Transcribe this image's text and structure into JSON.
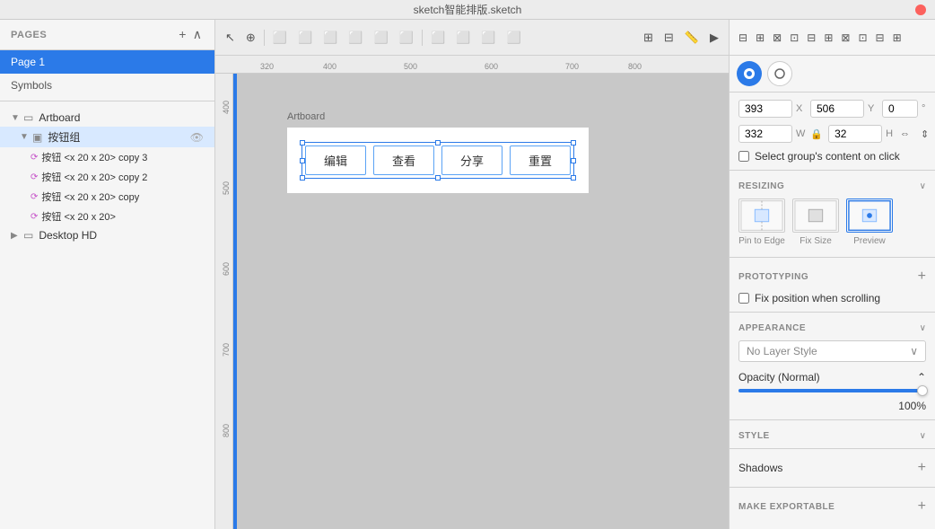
{
  "app": {
    "title": "sketch智能排版.sketch",
    "close_btn_label": "×"
  },
  "top_toolbar": {
    "align_buttons": [
      "⊞",
      "⊟",
      "⊠",
      "⊡",
      "⊞",
      "⊟",
      "⊠",
      "⊡"
    ],
    "align_labels": [
      "align-left",
      "align-center-h",
      "align-right",
      "align-top",
      "align-center-v",
      "align-bottom",
      "distribute-h",
      "distribute-v",
      "resize-w",
      "resize-h"
    ]
  },
  "left_panel": {
    "pages_label": "PAGES",
    "pages": [
      {
        "name": "Page 1",
        "active": true
      },
      {
        "name": "Symbols",
        "active": false
      }
    ],
    "layer_tree": [
      {
        "type": "artboard",
        "name": "Artboard",
        "level": 0,
        "expanded": true
      },
      {
        "type": "group",
        "name": "按钮组",
        "level": 1,
        "expanded": true,
        "has_eye": true
      },
      {
        "type": "symbol",
        "name": "按钮 <x 20 x 20>  copy 3",
        "level": 2
      },
      {
        "type": "symbol",
        "name": "按钮 <x 20 x 20>  copy 2",
        "level": 2
      },
      {
        "type": "symbol",
        "name": "按钮 <x 20 x 20>  copy",
        "level": 2
      },
      {
        "type": "symbol",
        "name": "按钮 <x 20 x 20>",
        "level": 2
      },
      {
        "type": "artboard",
        "name": "Desktop HD",
        "level": 0,
        "expanded": false
      }
    ]
  },
  "canvas": {
    "ruler_ticks_h": [
      "320",
      "400",
      "500",
      "600",
      "700",
      "800"
    ],
    "ruler_ticks_v": [
      "400",
      "500",
      "600",
      "700",
      "800"
    ],
    "artboard_label": "Artboard",
    "buttons": [
      {
        "label": "编辑"
      },
      {
        "label": "查看"
      },
      {
        "label": "分享"
      },
      {
        "label": "重置"
      }
    ]
  },
  "right_panel": {
    "style_tabs": [
      {
        "type": "fill",
        "label": "fill-icon",
        "icon": "◈"
      },
      {
        "type": "border",
        "label": "border-icon",
        "icon": "◎"
      }
    ],
    "properties": {
      "x_label": "X",
      "x_value": "393",
      "y_label": "Y",
      "y_value": "506",
      "rotation_value": "0",
      "rotation_unit": "°",
      "w_label": "W",
      "w_value": "332",
      "h_label": "H",
      "h_value": "32"
    },
    "checkbox_group_content": "Select group's content on click",
    "resizing": {
      "title": "RESIZING",
      "options": [
        {
          "label": "Pin to Edge",
          "selected": false
        },
        {
          "label": "Fix Size",
          "selected": false
        },
        {
          "label": "Preview",
          "selected": true
        }
      ]
    },
    "prototyping": {
      "title": "PROTOTYPING",
      "fix_position_label": "Fix position when scrolling"
    },
    "appearance": {
      "title": "APPEARANCE",
      "layer_style_placeholder": "No Layer Style"
    },
    "opacity": {
      "label": "Opacity (Normal)",
      "value": "100%",
      "slider_value": 100
    },
    "style": {
      "title": "STYLE"
    },
    "shadows": {
      "title": "Shadows"
    },
    "make_exportable": {
      "title": "MAKE EXPORTABLE"
    }
  }
}
